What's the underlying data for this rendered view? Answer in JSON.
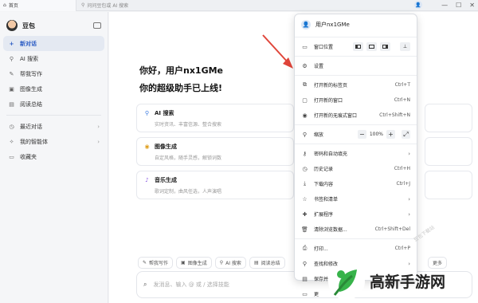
{
  "titlebar": {
    "tab_label": "首页",
    "address": "问问豆包或 AI 搜索",
    "controls": [
      "—",
      "☐",
      "✕"
    ]
  },
  "sidebar": {
    "brand": "豆包",
    "new_chat": "新对话",
    "items": [
      {
        "label": "AI 搜索",
        "icon": "search-icon"
      },
      {
        "label": "帮我写作",
        "icon": "pen-icon"
      },
      {
        "label": "图像生成",
        "icon": "image-icon"
      },
      {
        "label": "阅读总结",
        "icon": "book-icon"
      }
    ],
    "recent": "最近对话",
    "agents": "我的智能体",
    "favorites": "收藏夹"
  },
  "main": {
    "greeting": "你好，用户nx1GMe",
    "subgreeting": "你的超级助手已上线!",
    "cards": [
      {
        "title": "AI 搜索",
        "desc": "实时资讯、丰富信源、整合搜索",
        "icon": "search-icon",
        "color": "#3b7be0"
      },
      {
        "title": "图像生成",
        "desc": "自定风格，随手灵感，解锁词数",
        "icon": "palette-icon",
        "color": "#e0a020"
      },
      {
        "title": "音乐生成",
        "desc": "歌词定制，曲风任选，人声演唱",
        "icon": "music-icon",
        "color": "#8a5be0"
      }
    ],
    "chips": [
      "帮我写作",
      "图像生成",
      "AI 搜索",
      "阅读总结"
    ],
    "chip_right": "更多",
    "input_placeholder": "发消息、输入 @ 或 / 选择技能"
  },
  "menu": {
    "user": "用户nx1GMe",
    "window_position": "窗口位置",
    "settings": "设置",
    "new_tab": {
      "label": "打开新的标签页",
      "shortcut": "Ctrl+T"
    },
    "new_window": {
      "label": "打开新的窗口",
      "shortcut": "Ctrl+N"
    },
    "incognito": {
      "label": "打开新的无痕式窗口",
      "shortcut": "Ctrl+Shift+N"
    },
    "zoom": {
      "label": "缩放",
      "value": "100%"
    },
    "passwords": "密码和自动填充",
    "history": {
      "label": "历史记录",
      "shortcut": "Ctrl+H"
    },
    "downloads": {
      "label": "下载内容",
      "shortcut": "Ctrl+J"
    },
    "bookmarks": "书签和清单",
    "extensions": "扩展程序",
    "clear_data": {
      "label": "清除浏览数据...",
      "shortcut": "Ctrl+Shift+Del"
    },
    "print": {
      "label": "打印...",
      "shortcut": "Ctrl+P"
    },
    "find": "查找和修改",
    "save_share": "保存并分享",
    "more": "更"
  },
  "watermark": {
    "text": "高新手游网",
    "small": "豆包下载站"
  },
  "colors": {
    "accent": "#2b5cc4",
    "arrow": "#e0453a",
    "watermark_green": "#37b34a"
  }
}
